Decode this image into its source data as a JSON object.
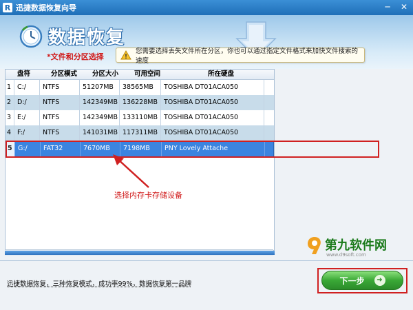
{
  "window": {
    "app_icon_letter": "R",
    "title": "迅捷数据恢复向导",
    "minimize_label": "─",
    "close_label": "✕"
  },
  "header": {
    "feature_title": "数据恢复",
    "subtitle": "*文件和分区选择",
    "tip": "您需要选择丢失文件所在分区，你也可以通过指定文件格式来加快文件搜索的速度",
    "arrow_icon_text": "选择"
  },
  "table": {
    "columns": [
      "盘符",
      "分区模式",
      "分区大小",
      "可用空间",
      "所在硬盘"
    ],
    "rows": [
      {
        "index": "1",
        "drive": "C:/",
        "fs": "NTFS",
        "size": "51207MB",
        "free": "38565MB",
        "disk": "TOSHIBA DT01ACA050"
      },
      {
        "index": "2",
        "drive": "D:/",
        "fs": "NTFS",
        "size": "142349MB",
        "free": "136228MB",
        "disk": "TOSHIBA DT01ACA050"
      },
      {
        "index": "3",
        "drive": "E:/",
        "fs": "NTFS",
        "size": "142349MB",
        "free": "133110MB",
        "disk": "TOSHIBA DT01ACA050"
      },
      {
        "index": "4",
        "drive": "F:/",
        "fs": "NTFS",
        "size": "141031MB",
        "free": "117311MB",
        "disk": "TOSHIBA DT01ACA050"
      },
      {
        "index": "5",
        "drive": "G:/",
        "fs": "FAT32",
        "size": "7670MB",
        "free": "7198MB",
        "disk": "PNY Lovely Attache"
      }
    ],
    "selected_index": 5
  },
  "annotation": {
    "text": "选择内存卡存储设备"
  },
  "watermark": {
    "text": "第九软件网",
    "sub": "www.d9soft.com"
  },
  "footer": {
    "text": "迅捷数据恢复，三种恢复模式，成功率99%，数据恢复第一品牌",
    "next_label": "下一步",
    "next_arrow": "➜"
  },
  "colors": {
    "titlebar": "#1f6fb8",
    "selected_row": "#3b84e0",
    "highlight_red": "#d02020",
    "next_green": "#3aa836"
  }
}
